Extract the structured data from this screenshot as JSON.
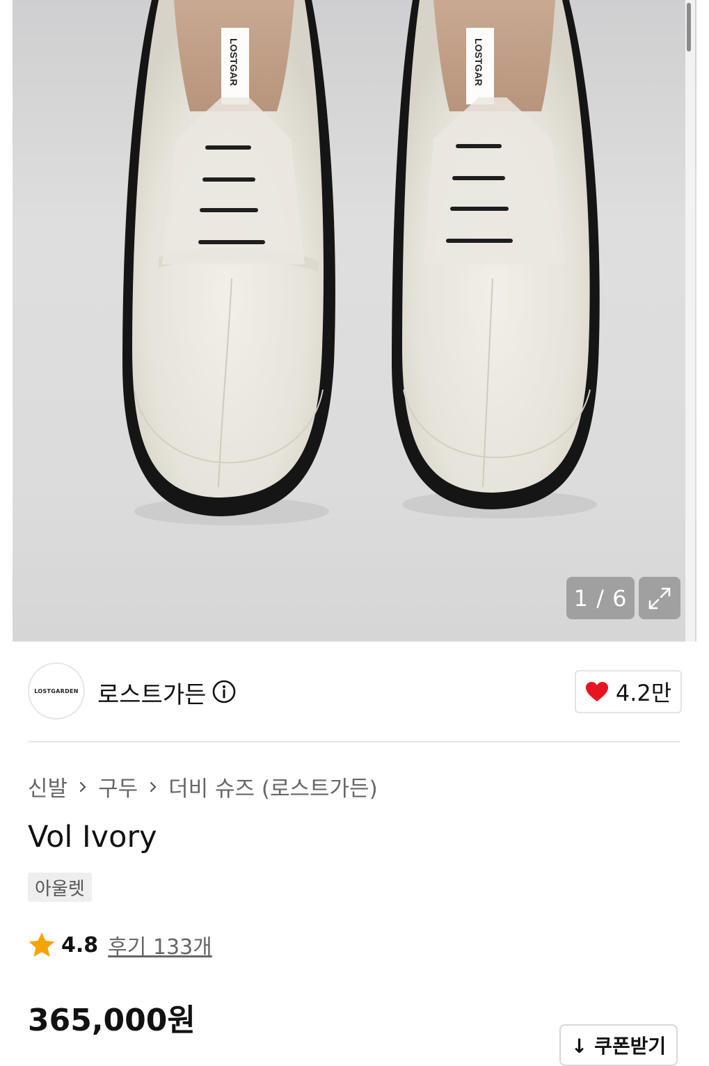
{
  "gallery": {
    "counter": "1 / 6",
    "insole_label": "LOSTGAR"
  },
  "brand": {
    "logo_text": "LOSTGARDEN",
    "name": "로스트가든",
    "like_count": "4.2만"
  },
  "breadcrumb": [
    "신발",
    "구두",
    "더비 슈즈 (로스트가든)"
  ],
  "product": {
    "title": "Vol Ivory",
    "badge": "아울렛",
    "rating": "4.8",
    "review_link": "후기 133개",
    "price": "365,000원"
  },
  "coupon": {
    "label": "↓ 쿠폰받기"
  },
  "colors": {
    "heart": "#e8141f",
    "star": "#f5a300",
    "shoe_leather": "#e9e7df",
    "sole": "#141414"
  }
}
